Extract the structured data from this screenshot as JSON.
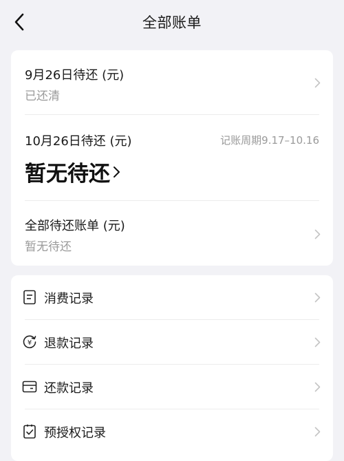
{
  "header": {
    "title": "全部账单"
  },
  "bills": [
    {
      "title": "9月26日待还 (元)",
      "status": "已还清"
    },
    {
      "title": "10月26日待还 (元)",
      "period": "记账周期9.17–10.16",
      "status": "暂无待还"
    },
    {
      "title": "全部待还账单 (元)",
      "status": "暂无待还"
    }
  ],
  "records": [
    {
      "label": "消费记录",
      "icon": "receipt-icon"
    },
    {
      "label": "退款记录",
      "icon": "refund-icon"
    },
    {
      "label": "还款记录",
      "icon": "card-icon"
    },
    {
      "label": "预授权记录",
      "icon": "pre-auth-icon"
    }
  ],
  "colors": {
    "background": "#f2f2f6",
    "card": "#ffffff",
    "secondary_text": "#9a9a9a"
  }
}
